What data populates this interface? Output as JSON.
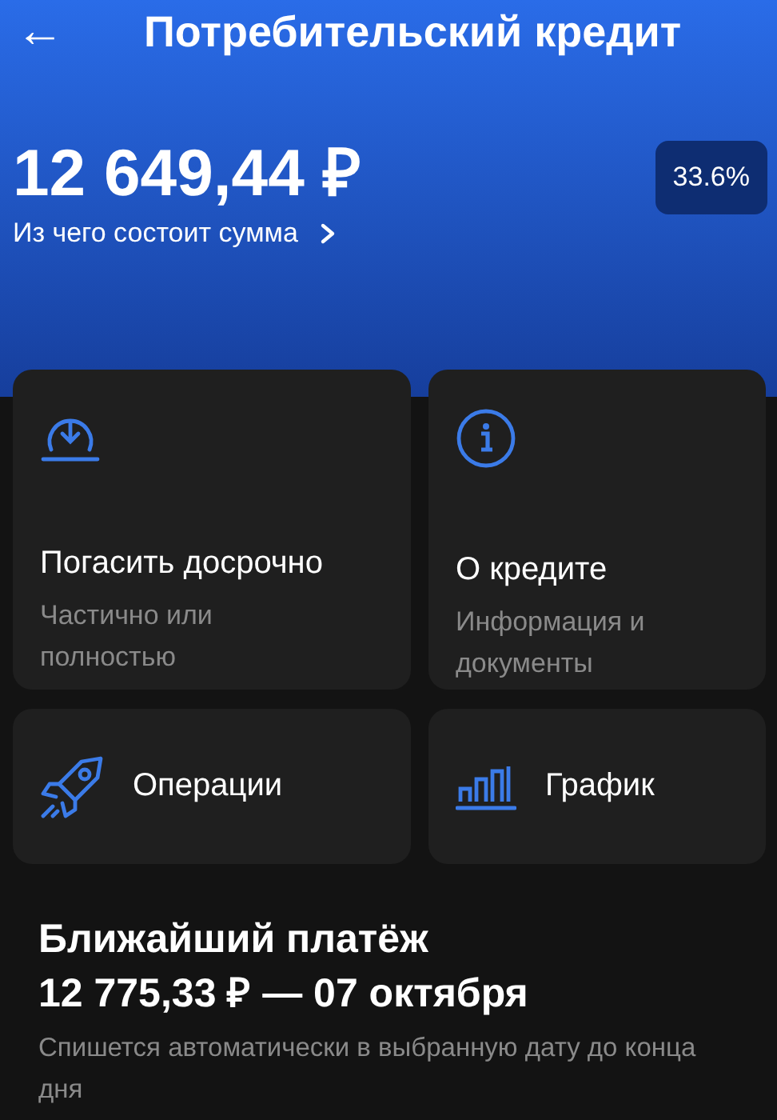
{
  "header": {
    "back": "←",
    "title": "Потребительский кредит"
  },
  "balance": {
    "amount": "12 649,44 ₽",
    "rate": "33.6%",
    "link": "Из чего состоит сумма"
  },
  "tiles": [
    {
      "kind": "large",
      "title": "Погасить досрочно",
      "subtitle": "Частично или полностью"
    },
    {
      "kind": "large",
      "title": "О кредите",
      "subtitle": "Информация и документы"
    },
    {
      "kind": "compact",
      "title": "Операции"
    },
    {
      "kind": "compact",
      "title": "График"
    }
  ],
  "next_payment": {
    "title": "Ближайший платёж",
    "amount": "12 775,33 ₽ — 07 октября",
    "note": "Спишется автоматически в выбранную дату до конца дня"
  }
}
